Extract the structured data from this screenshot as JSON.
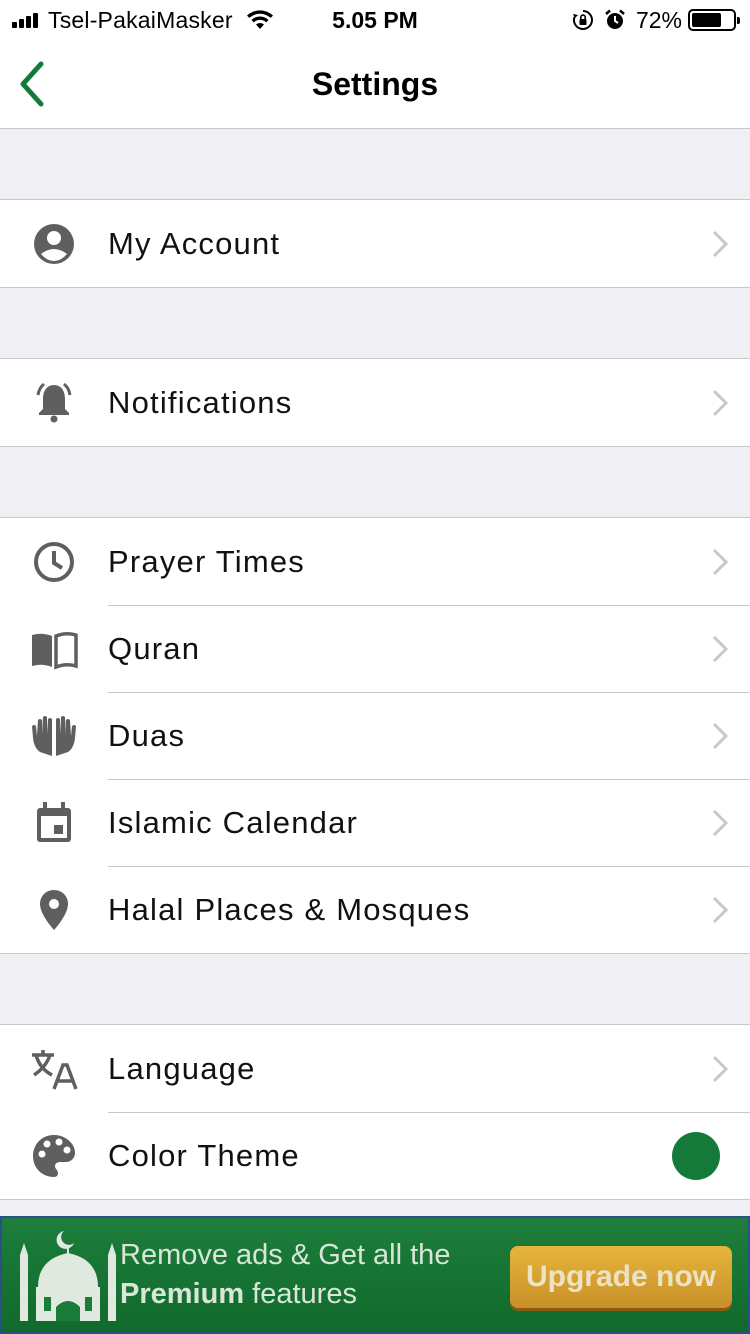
{
  "status_bar": {
    "carrier": "Tsel-PakaiMasker",
    "time": "5.05 PM",
    "battery_percent": "72%",
    "battery_level": 0.72,
    "icons": [
      "signal-icon",
      "wifi-icon",
      "orientation-lock-icon",
      "alarm-icon",
      "battery-icon"
    ]
  },
  "nav": {
    "title": "Settings",
    "back_icon": "chevron-left-icon"
  },
  "groups": [
    {
      "items": [
        {
          "label": "My Account",
          "icon": "account-icon"
        }
      ]
    },
    {
      "items": [
        {
          "label": "Notifications",
          "icon": "bell-icon"
        }
      ]
    },
    {
      "items": [
        {
          "label": "Prayer Times",
          "icon": "clock-icon"
        },
        {
          "label": "Quran",
          "icon": "book-icon"
        },
        {
          "label": "Duas",
          "icon": "praying-hands-icon"
        },
        {
          "label": "Islamic Calendar",
          "icon": "calendar-icon"
        },
        {
          "label": "Halal Places & Mosques",
          "icon": "location-pin-icon"
        }
      ]
    },
    {
      "items": [
        {
          "label": "Language",
          "icon": "translate-icon"
        },
        {
          "label": "Color Theme",
          "icon": "palette-icon",
          "value_color": "#137a3a"
        }
      ]
    }
  ],
  "banner": {
    "line1": "Remove ads & Get all the",
    "line2_bold": "Premium",
    "line2_rest": " features",
    "button": "Upgrade now",
    "icon": "mosque-icon"
  },
  "colors": {
    "accent": "#137a3a",
    "separator": "#c8c7cc",
    "group_background": "#efeff4",
    "icon_gray": "#5f5f5f",
    "chevron_gray": "#c7c7cc"
  }
}
